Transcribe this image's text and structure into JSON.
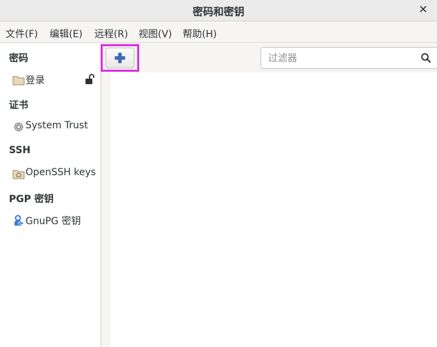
{
  "window": {
    "title": "密码和密钥",
    "close_glyph": "✕"
  },
  "menu": [
    {
      "label": "文件(F)"
    },
    {
      "label": "编辑(E)"
    },
    {
      "label": "远程(R)"
    },
    {
      "label": "视图(V)"
    },
    {
      "label": "帮助(H)"
    }
  ],
  "sidebar": {
    "sections": [
      {
        "header": "密码",
        "item": "登录",
        "icon": "folder-icon"
      },
      {
        "header": "证书",
        "item": "System Trust",
        "icon": "gear-icon"
      },
      {
        "header": "SSH",
        "item": "OpenSSH keys",
        "icon": "home-folder-icon"
      },
      {
        "header": "PGP 密钥",
        "item": "GnuPG 密钥",
        "icon": "person-key-icon"
      }
    ]
  },
  "toolbar": {
    "add_icon": "plus-icon",
    "filter_placeholder": "过滤器",
    "search_icon": "search-icon"
  },
  "colors": {
    "highlight": "#e030e0",
    "plus": "#3a6cc4"
  }
}
